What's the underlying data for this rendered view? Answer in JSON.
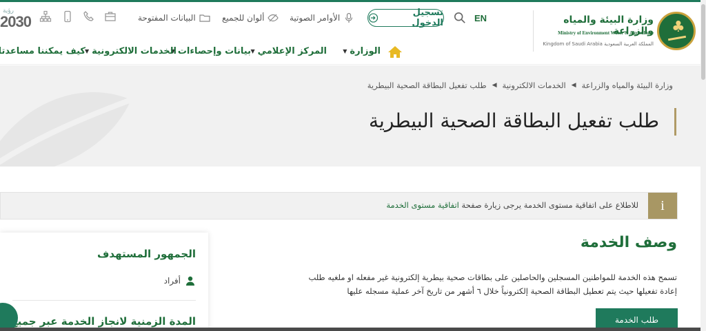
{
  "header": {
    "ministry_ar": "وزارة البيئة والمياه والزراعة",
    "ministry_en": "Ministry of Environment Water & Agriculture",
    "kingdom": "Kingdom of Saudi Arabia المملكة العربية السعودية",
    "lang": "EN",
    "login_label": "تسجيل الدخول",
    "voice_label": "الأوامر الصوتية",
    "colors_label": "ألوان للجميع",
    "open_data_label": "البيانات المفتوحة",
    "vision_top": "رؤية",
    "vision_num": "2030"
  },
  "nav": {
    "items": [
      {
        "label": "الوزارة"
      },
      {
        "label": "المركز الإعلامي"
      },
      {
        "label": "بيانات وإحصاءات"
      },
      {
        "label": "الخدمات الالكترونية"
      },
      {
        "label": "كيف يمكننا مساعدتك"
      }
    ]
  },
  "breadcrumb": {
    "items": [
      "وزارة البيئة والمياه والزراعة",
      "الخدمات الالكترونية",
      "طلب تفعيل البطاقة الصحية البيطرية"
    ]
  },
  "page": {
    "title": "طلب تفعيل البطاقة الصحية البيطرية"
  },
  "info": {
    "text_prefix": "للاطلاع على اتفاقية مستوى الخدمة يرجى زيارة صفحة",
    "link": "اتفاقية مستوى الخدمة",
    "icon_char": "i"
  },
  "service": {
    "title": "وصف الخدمة",
    "description": "تسمح هذه الخدمة للمواطنين المسجلين والحاصلين على بطاقات صحية بيطرية إلكترونية غير مفعله او ملغيه طلب إعادة تفعيلها حيث يتم تعطيل البطاقة الصحية إلكترونياً خلال ٦ أشهر من تاريخ آخر عملية مسجله عليها",
    "request_button": "طلب الخدمة"
  },
  "card": {
    "audience_title": "الجمهور المستهدف",
    "audience_item": "أفراد",
    "duration_title": "المدة الزمنية لانجاز الخدمة عبر جميع"
  },
  "colors": {
    "brand_green": "#1f7a5c",
    "gold": "#a89764"
  }
}
